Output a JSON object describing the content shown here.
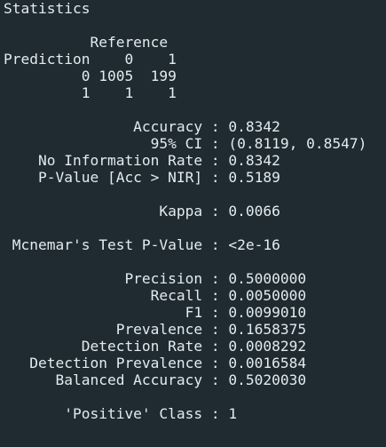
{
  "header": {
    "title": "Statistics"
  },
  "confusion_matrix": {
    "lines": [
      "          Reference",
      "Prediction    0    1",
      "         0 1005  199",
      "         1    1    1"
    ]
  },
  "metrics": {
    "lines": [
      "               Accuracy : 0.8342",
      "                 95% CI : (0.8119, 0.8547)",
      "    No Information Rate : 0.8342",
      "    P-Value [Acc > NIR] : 0.5189",
      "",
      "                  Kappa : 0.0066",
      "",
      " Mcnemar's Test P-Value : <2e-16",
      "",
      "              Precision : 0.5000000",
      "                 Recall : 0.0050000",
      "                     F1 : 0.0099010",
      "             Prevalence : 0.1658375",
      "         Detection Rate : 0.0008292",
      "   Detection Prevalence : 0.0016584",
      "      Balanced Accuracy : 0.5020030",
      "",
      "       'Positive' Class : 1"
    ]
  }
}
